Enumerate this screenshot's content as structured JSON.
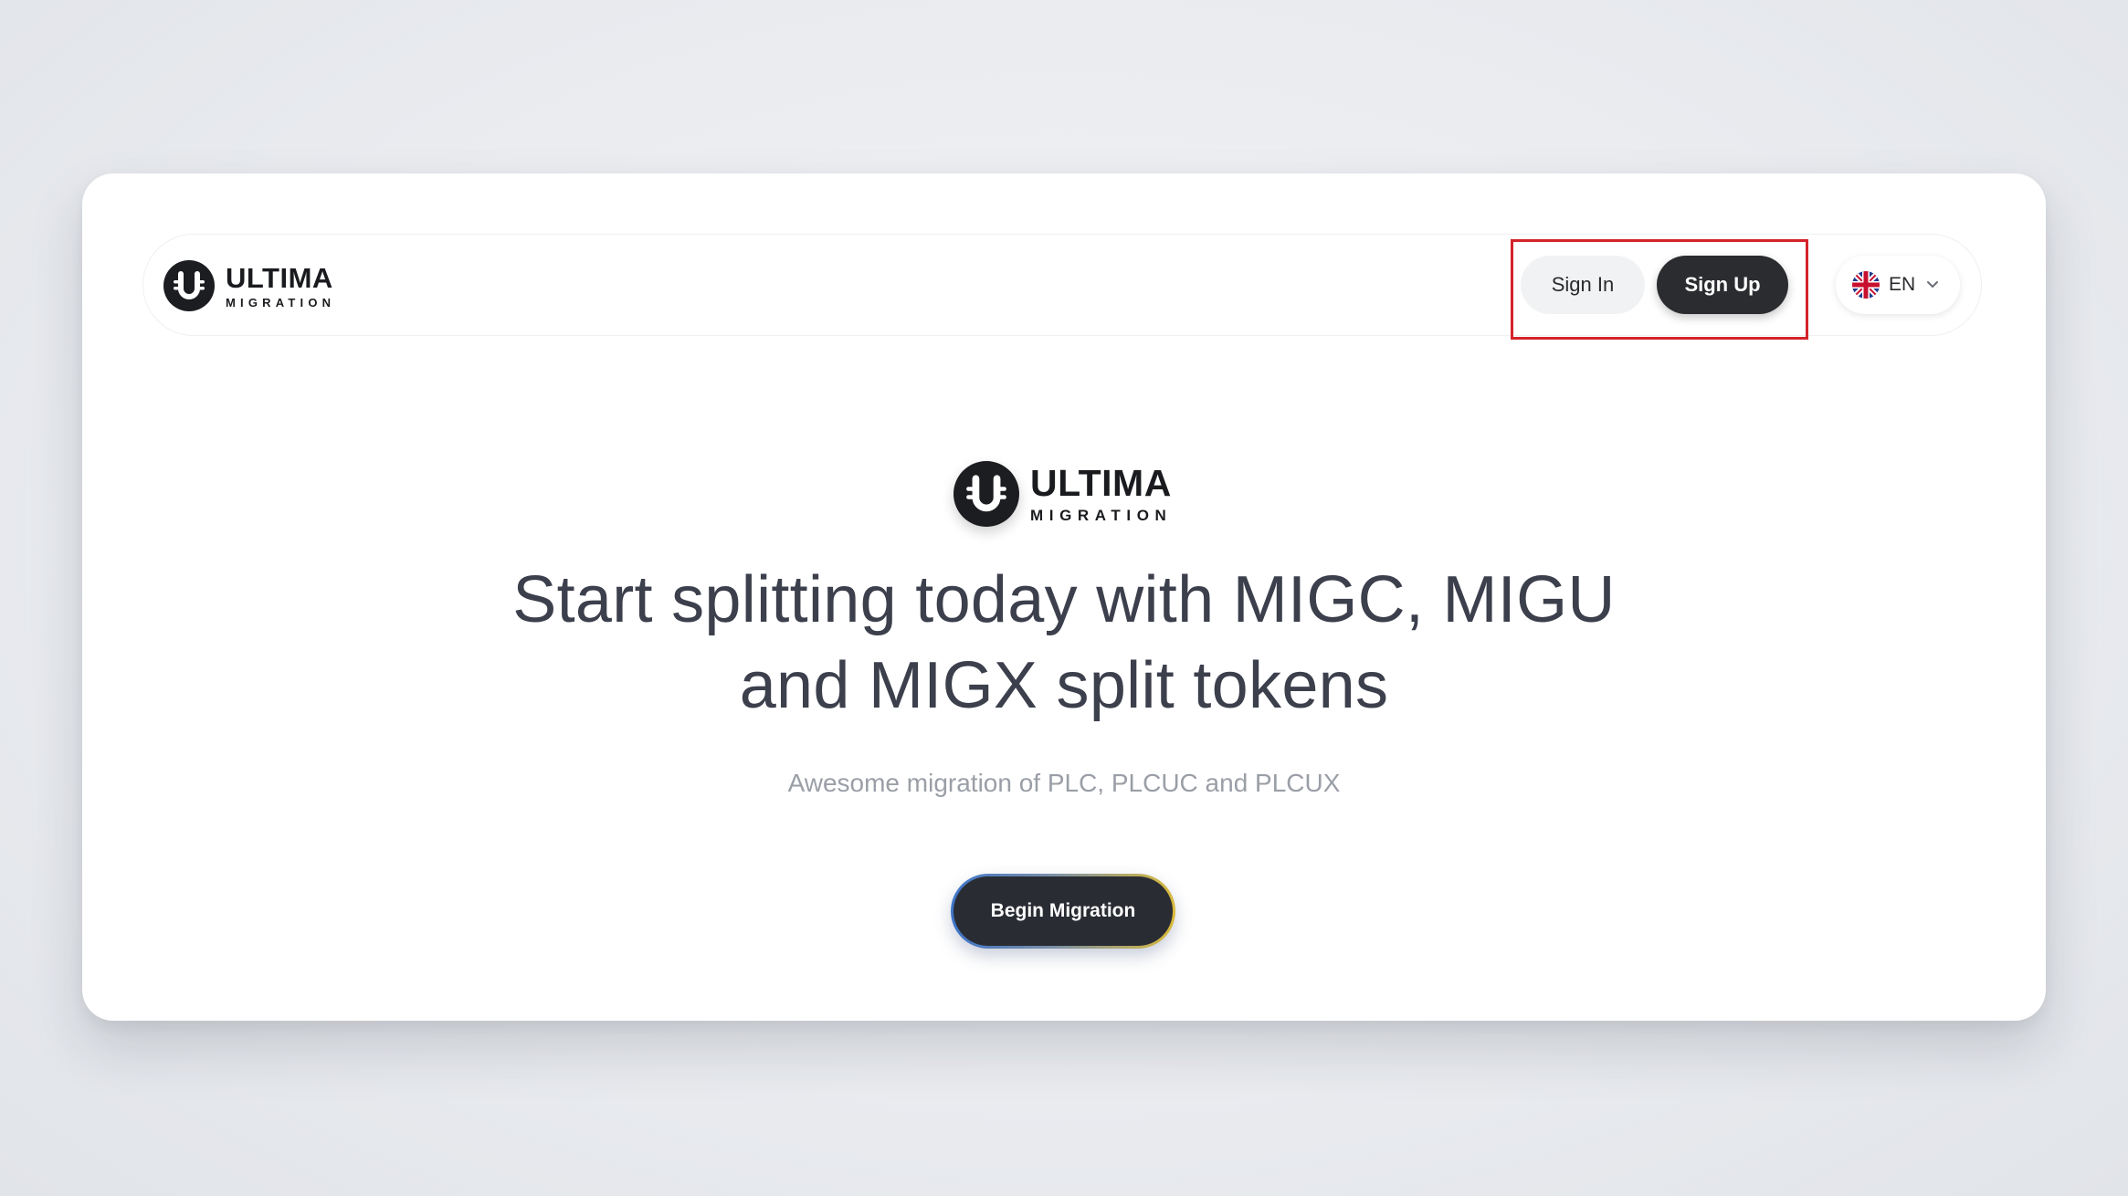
{
  "brand": {
    "title": "ULTIMA",
    "subtitle": "MIGRATION"
  },
  "nav": {
    "sign_in_label": "Sign In",
    "sign_up_label": "Sign Up",
    "language": {
      "selected": "EN",
      "flag_icon": "uk-flag-icon",
      "chevron_icon": "chevron-down-icon"
    }
  },
  "hero": {
    "headline_line1": "Start splitting today with MIGC, MIGU",
    "headline_line2": "and MIGX split tokens",
    "subtitle": "Awesome migration of PLC, PLCUC and PLCUX",
    "cta_label": "Begin Migration"
  },
  "colors": {
    "highlight": "#d4232a",
    "primary_dark": "#2b2c2f",
    "headline": "#3c3f4c",
    "subtitle": "#9a9ea6"
  }
}
